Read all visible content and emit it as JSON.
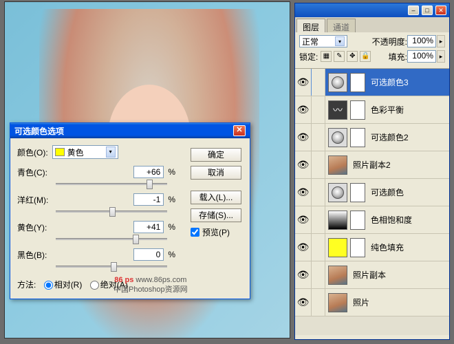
{
  "canvas": {
    "desc": "portrait-photo"
  },
  "dialog": {
    "title": "可选颜色选项",
    "color_label": "颜色(O):",
    "color_value": "黄色",
    "sliders": {
      "cyan": {
        "label": "青色(C):",
        "value": "+66"
      },
      "magenta": {
        "label": "洋红(M):",
        "value": "-1"
      },
      "yellow": {
        "label": "黄色(Y):",
        "value": "+41"
      },
      "black": {
        "label": "黑色(B):",
        "value": "0"
      }
    },
    "pct_sign": "%",
    "method_label": "方法:",
    "method_relative": "相对(R)",
    "method_absolute": "绝对(A)",
    "buttons": {
      "ok": "确定",
      "cancel": "取消",
      "load": "载入(L)...",
      "save": "存储(S)..."
    },
    "preview": "预览(P)"
  },
  "watermark": {
    "brand": "86 ps",
    "url": "www.86ps.com",
    "tagline": "中国Photoshop资源网"
  },
  "panel": {
    "tabs": {
      "layers": "图层",
      "channels": "通道"
    },
    "blend_label": "",
    "blend_mode": "正常",
    "opacity_label": "不透明度:",
    "opacity_value": "100%",
    "lock_label": "锁定:",
    "fill_label": "填充:",
    "fill_value": "100%",
    "layers": [
      {
        "name": "可选颜色3",
        "type": "adj",
        "selected": true
      },
      {
        "name": "色彩平衡",
        "type": "curves",
        "selected": false
      },
      {
        "name": "可选颜色2",
        "type": "adj",
        "selected": false
      },
      {
        "name": "照片副本2",
        "type": "photo",
        "selected": false
      },
      {
        "name": "可选颜色",
        "type": "adj",
        "selected": false
      },
      {
        "name": "色相饱和度",
        "type": "grad",
        "selected": false
      },
      {
        "name": "纯色填充",
        "type": "yellow",
        "selected": false
      },
      {
        "name": "照片副本",
        "type": "photo",
        "selected": false
      },
      {
        "name": "照片",
        "type": "photo",
        "selected": false
      }
    ]
  }
}
